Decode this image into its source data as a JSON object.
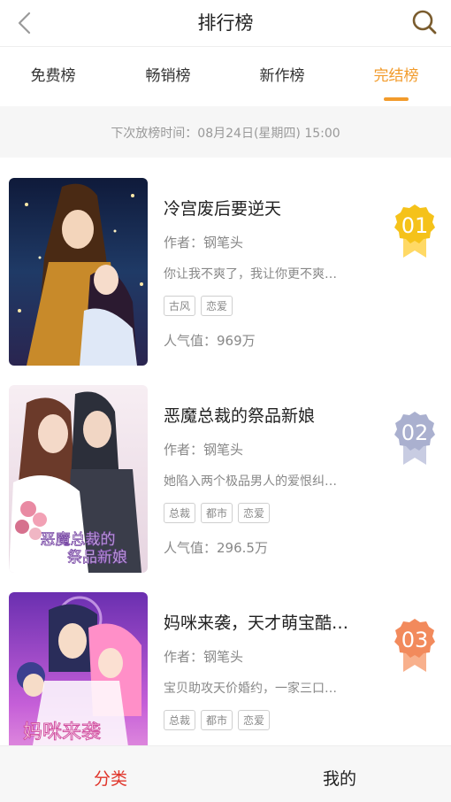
{
  "header": {
    "title": "排行榜",
    "back_icon": "chevron-left-icon",
    "search_icon": "search-icon"
  },
  "tabs": [
    {
      "label": "免费榜",
      "active": false
    },
    {
      "label": "畅销榜",
      "active": false
    },
    {
      "label": "新作榜",
      "active": false
    },
    {
      "label": "完结榜",
      "active": true
    }
  ],
  "accent_color": "#f29b2b",
  "notice": "下次放榜时间：08月24日(星期四) 15:00",
  "list": [
    {
      "rank": "01",
      "rank_color": "#f5c21a",
      "title": "冷宫废后要逆天",
      "author": "作者：钢笔头",
      "desc": "你让我不爽了，我让你更不爽…",
      "tags": [
        "古风",
        "恋爱"
      ],
      "popularity": "人气值：969万"
    },
    {
      "rank": "02",
      "rank_color": "#aab0cf",
      "title": "恶魔总裁的祭品新娘",
      "author": "作者：钢笔头",
      "desc": "她陷入两个极品男人的爱恨纠…",
      "tags": [
        "总裁",
        "都市",
        "恋爱"
      ],
      "popularity": "人气值：296.5万",
      "cover_text": "恶魔总裁的祭品新娘"
    },
    {
      "rank": "03",
      "rank_color": "#f28a5c",
      "title": "妈咪来袭，天才萌宝酷…",
      "author": "作者：钢笔头",
      "desc": "宝贝助攻天价婚约，一家三口…",
      "tags": [
        "总裁",
        "都市",
        "恋爱"
      ],
      "popularity": "",
      "cover_text": "妈咪来袭"
    }
  ],
  "bottom_nav": [
    {
      "label": "分类",
      "color": "#e0352b"
    },
    {
      "label": "我的",
      "color": "#222222"
    }
  ]
}
